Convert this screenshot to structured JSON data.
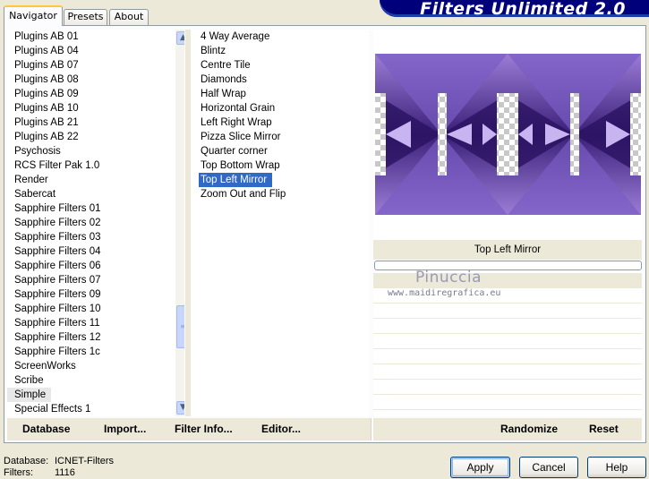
{
  "tabs": [
    "Navigator",
    "Presets",
    "About"
  ],
  "banner_title": "Filters Unlimited 2.0",
  "categories": [
    "Plugins AB 01",
    "Plugins AB 04",
    "Plugins AB 07",
    "Plugins AB 08",
    "Plugins AB 09",
    "Plugins AB 10",
    "Plugins AB 21",
    "Plugins AB 22",
    "Psychosis",
    "RCS Filter Pak 1.0",
    "Render",
    "Sabercat",
    "Sapphire Filters 01",
    "Sapphire Filters 02",
    "Sapphire Filters 03",
    "Sapphire Filters 04",
    "Sapphire Filters 06",
    "Sapphire Filters 07",
    "Sapphire Filters 09",
    "Sapphire Filters 10",
    "Sapphire Filters 11",
    "Sapphire Filters 12",
    "Sapphire Filters 1c",
    "ScreenWorks",
    "Scribe",
    "Simple",
    "Special Effects 1"
  ],
  "selected_category": "Simple",
  "filters": [
    "4 Way Average",
    "Blintz",
    "Centre Tile",
    "Diamonds",
    "Half Wrap",
    "Horizontal Grain",
    "Left Right Wrap",
    "Pizza Slice Mirror",
    "Quarter corner",
    "Top Bottom Wrap",
    "Top Left Mirror",
    "Zoom Out and Flip"
  ],
  "selected_filter": "Top Left Mirror",
  "preview_label": "Top Left Mirror",
  "watermark": {
    "name": "Pinuccia",
    "url": "www.maidiregrafica.eu"
  },
  "toolbar": {
    "database": "Database",
    "import": "Import...",
    "filter_info": "Filter Info...",
    "editor": "Editor...",
    "randomize": "Randomize",
    "reset": "Reset"
  },
  "status": {
    "database_label": "Database:",
    "database_value": "ICNET-Filters",
    "filters_label": "Filters:",
    "filters_value": "1116"
  },
  "buttons": {
    "apply": "Apply",
    "cancel": "Cancel",
    "help": "Help"
  },
  "colors": {
    "banner": "#00007b",
    "selection": "#316ac5",
    "preview_purple": "#6b47b0"
  },
  "icons": {
    "scroll_up": "▲",
    "scroll_down": "▼",
    "thumb_grip": "≡"
  }
}
